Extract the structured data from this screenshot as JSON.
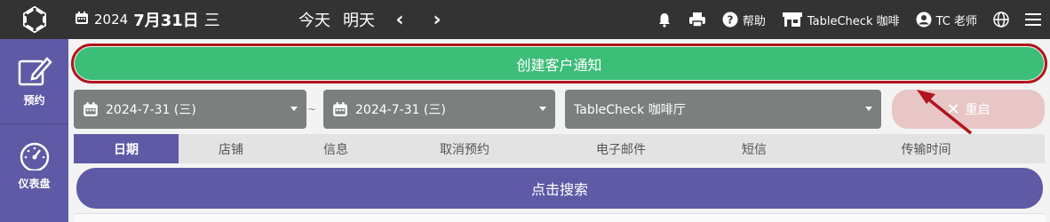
{
  "header": {
    "date_year": "2024",
    "date_monthday": "7月31日",
    "date_weekday": "三",
    "today": "今天",
    "tomorrow": "明天",
    "help": "帮助",
    "venue": "TableCheck 咖啡",
    "user": "TC 老师"
  },
  "sidebar": {
    "items": [
      {
        "label": "预约",
        "icon": "edit-icon"
      },
      {
        "label": "仪表盘",
        "icon": "gauge-icon"
      }
    ]
  },
  "main": {
    "create_label": "创建客户通知",
    "date_from": "2024-7-31 (三)",
    "date_to": "2024-7-31 (三)",
    "date_separator": "~",
    "venue_select": "TableCheck 咖啡厅",
    "reset_label": "重启",
    "tabs": [
      {
        "label": "日期"
      },
      {
        "label": "店铺"
      },
      {
        "label": "信息"
      },
      {
        "label": "取消预约"
      },
      {
        "label": "电子邮件"
      },
      {
        "label": "短信"
      },
      {
        "label": "传输时间"
      }
    ],
    "search_label": "点击搜索"
  },
  "colors": {
    "topbar": "#333333",
    "sidebar": "#5e5aa5",
    "create": "#3cbd78",
    "highlight": "#b0151b",
    "reset": "#e8c6c6"
  }
}
